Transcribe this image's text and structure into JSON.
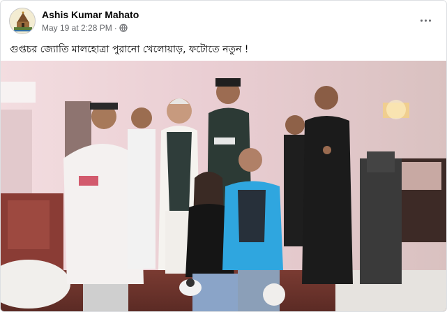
{
  "post": {
    "author_name": "Ashis Kumar Mahato",
    "timestamp": "May 19 at 2:28 PM",
    "separator": "·",
    "privacy_icon": "globe-icon",
    "more_icon": "more-options-icon",
    "caption": "গুপ্তচর জ্যোতি মালহোত্রা পুরানো খেলোয়াড়, ফটোতে নতুন !",
    "photo_icon": "group-photo"
  },
  "colors": {
    "name": "#050505",
    "meta": "#65676b",
    "border": "#dddfe2"
  }
}
